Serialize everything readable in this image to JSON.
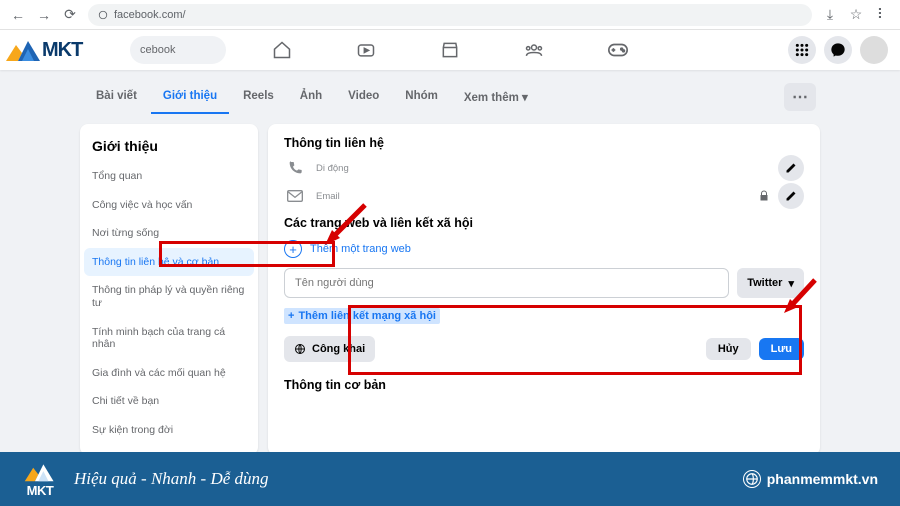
{
  "browser": {
    "url": "facebook.com/"
  },
  "fb": {
    "search_placeholder": "cebook"
  },
  "tabs": {
    "items": [
      "Bài viết",
      "Giới thiệu",
      "Reels",
      "Ảnh",
      "Video",
      "Nhóm",
      "Xem thêm ▾"
    ],
    "active_index": 1
  },
  "sidebar": {
    "title": "Giới thiệu",
    "items": [
      "Tổng quan",
      "Công việc và học vấn",
      "Nơi từng sống",
      "Thông tin liên hệ và cơ bản",
      "Thông tin pháp lý và quyền riêng tư",
      "Tính minh bạch của trang cá nhân",
      "Gia đình và các mối quan hệ",
      "Chi tiết về bạn",
      "Sự kiện trong đời"
    ],
    "active_index": 3
  },
  "content": {
    "contact_title": "Thông tin liên hệ",
    "mobile_label": "Di động",
    "email_label": "Email",
    "web_social_title": "Các trang web và liên kết xã hội",
    "add_website": "Thêm một trang web",
    "username_placeholder": "Tên người dùng",
    "platform": "Twitter",
    "add_social_link": "Thêm liên kết mạng xã hội",
    "public": "Công khai",
    "cancel": "Hủy",
    "save": "Lưu",
    "basic_info_title": "Thông tin cơ bản"
  },
  "banner": {
    "brand": "MKT",
    "slogan": "Hiệu quả - Nhanh  - Dễ dùng",
    "site": "phanmemmkt.vn"
  }
}
